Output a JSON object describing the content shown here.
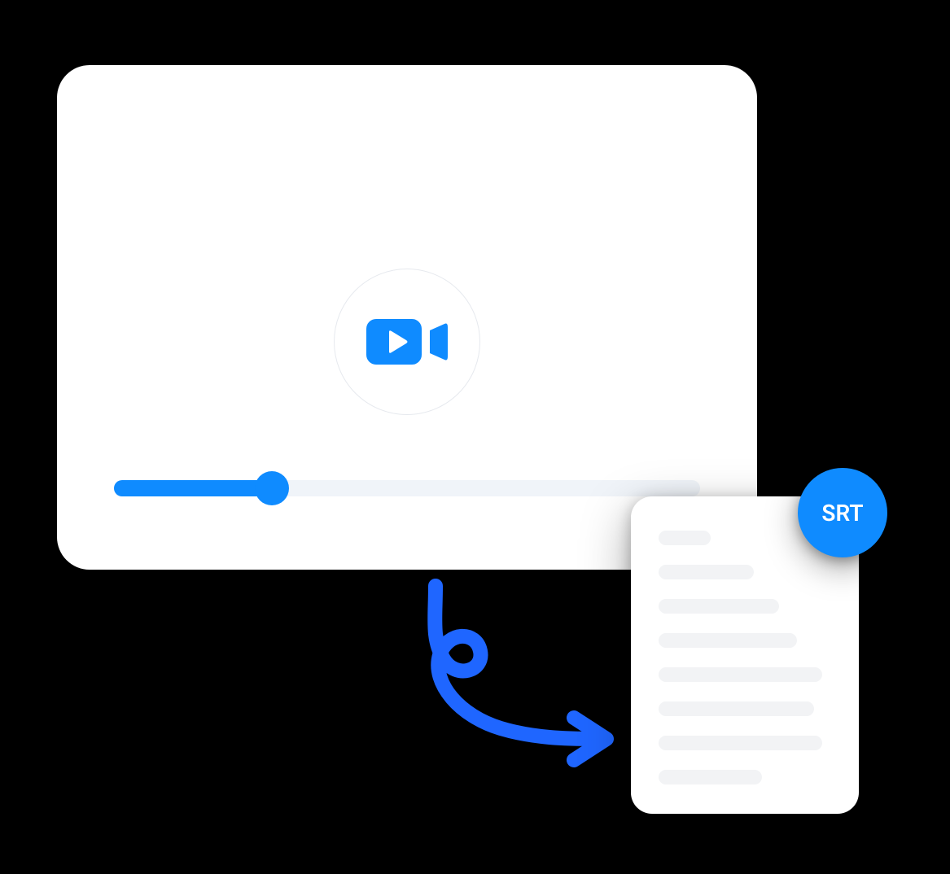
{
  "badge": {
    "label": "SRT"
  },
  "colors": {
    "accent": "#0f8bff",
    "card_bg": "#ffffff",
    "line": "#f2f3f5"
  },
  "progress": {
    "percent": 27
  },
  "icons": {
    "play_button": "video-camera-icon",
    "arrow": "curly-arrow-icon"
  }
}
